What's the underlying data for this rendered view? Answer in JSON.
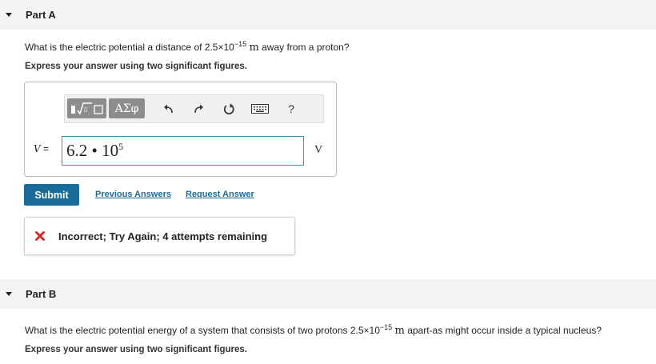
{
  "part_a": {
    "title": "Part A",
    "question": {
      "prefix": "What is the electric potential a distance of 2.5×10",
      "exponent": "−15",
      "unit": "m",
      "suffix": "away from a proton?"
    },
    "instruction": "Express your answer using two significant figures.",
    "toolbar": {
      "template_symbol": "√□",
      "greek_label": "ΑΣφ",
      "help_label": "?"
    },
    "answer": {
      "variable": "V",
      "equals": "=",
      "mantissa": "6.2 •",
      "base": "10",
      "exponent": "5",
      "unit": "V"
    },
    "submit_label": "Submit",
    "previous_answers_label": "Previous Answers",
    "request_answer_label": "Request Answer",
    "feedback": {
      "message": "Incorrect; Try Again; 4 attempts remaining",
      "status_color": "#d9231e"
    }
  },
  "part_b": {
    "title": "Part B",
    "question": {
      "prefix": "What is the electric potential energy of a system that consists of two protons 2.5×10",
      "exponent": "−15",
      "unit": "m",
      "suffix": "apart-as might occur inside a typical nucleus?"
    },
    "instruction": "Express your answer using two significant figures."
  },
  "colors": {
    "accent": "#1b6b98",
    "input_border": "#3b93b8",
    "header_bg": "#f3f3f3"
  }
}
